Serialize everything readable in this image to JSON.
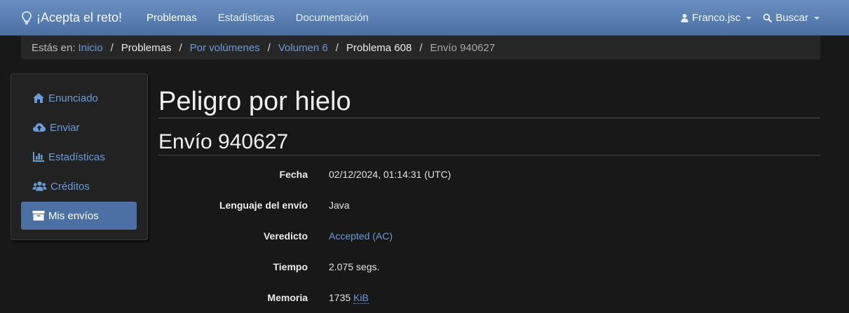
{
  "brand": {
    "name": "¡Acepta el reto!",
    "icon": "lightbulb-icon"
  },
  "nav": {
    "links": [
      "Problemas",
      "Estadísticas",
      "Documentación"
    ],
    "user": "Franco.jsc",
    "search": "Buscar"
  },
  "breadcrumb": {
    "prefix": "Estás en:",
    "items": [
      "Inicio",
      "Problemas",
      "Por volúmenes",
      "Volumen 6",
      "Problema 608",
      "Envío 940627"
    ]
  },
  "sidebar": {
    "items": [
      {
        "label": "Enunciado",
        "icon": "home-icon"
      },
      {
        "label": "Enviar",
        "icon": "cloud-upload-icon"
      },
      {
        "label": "Estadísticas",
        "icon": "bar-chart-icon"
      },
      {
        "label": "Créditos",
        "icon": "users-icon"
      },
      {
        "label": "Mis envíos",
        "icon": "archive-icon"
      }
    ]
  },
  "main": {
    "title": "Peligro por hielo",
    "subtitle": "Envío 940627",
    "details": [
      {
        "label": "Fecha",
        "value": "02/12/2024, 01:14:31 (UTC)"
      },
      {
        "label": "Lenguaje del envío",
        "value": "Java"
      },
      {
        "label": "Veredicto",
        "value": "Accepted (AC)"
      },
      {
        "label": "Tiempo",
        "value": "2.075 segs."
      },
      {
        "label": "Memoria",
        "value": "1735",
        "unit": "KiB"
      }
    ]
  },
  "colors": {
    "navbar": "#4a70a4",
    "link": "#6b9bd8",
    "background": "#181818"
  }
}
